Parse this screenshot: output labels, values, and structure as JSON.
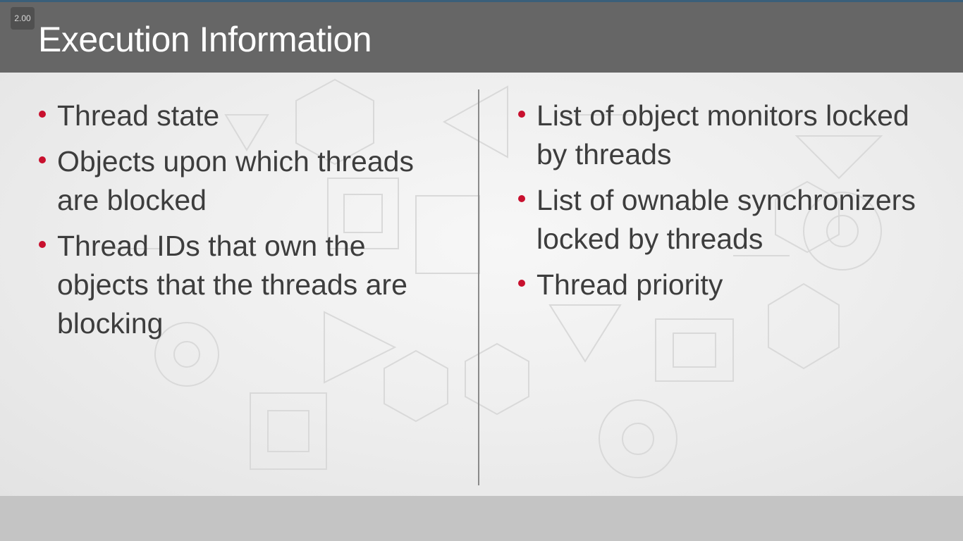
{
  "player": {
    "playback_speed": "2.00"
  },
  "slide": {
    "title": "Execution Information",
    "left_bullets": [
      "Thread state",
      "Objects upon which threads are blocked",
      "Thread IDs that own the objects that the threads are blocking"
    ],
    "right_bullets": [
      "List of object monitors locked by threads",
      "List of ownable synchronizers locked by threads",
      "Thread priority"
    ]
  },
  "colors": {
    "header_bg": "#666666",
    "bullet_accent": "#c8102e",
    "body_text": "#3d3d3d",
    "title_text": "#ffffff"
  }
}
